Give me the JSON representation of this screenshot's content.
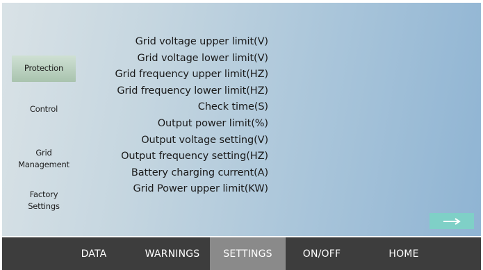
{
  "sidebar": {
    "items": [
      {
        "label": "Protection",
        "active": true
      },
      {
        "label": "Control",
        "active": false
      },
      {
        "label": "Grid\nManagement",
        "active": false
      },
      {
        "label": "Factory\nSettings",
        "active": false
      }
    ]
  },
  "params": [
    "Grid voltage upper limit(V)",
    "Grid voltage lower limit(V)",
    "Grid frequency upper limit(HZ)",
    "Grid frequency lower limit(HZ)",
    "Check time(S)",
    "Output power limit(%)",
    "Output voltage setting(V)",
    "Output frequency setting(HZ)",
    "Battery charging current(A)",
    "Grid Power upper limit(KW)"
  ],
  "next_button": {
    "icon": "arrow-right-icon",
    "glyph": "⟶",
    "color": "#7fd0c7"
  },
  "navbar": {
    "items": [
      {
        "label": "DATA",
        "active": false
      },
      {
        "label": "WARNINGS",
        "active": false
      },
      {
        "label": "SETTINGS",
        "active": true
      },
      {
        "label": "ON/OFF",
        "active": false
      },
      {
        "label": "HOME",
        "active": false
      }
    ]
  }
}
